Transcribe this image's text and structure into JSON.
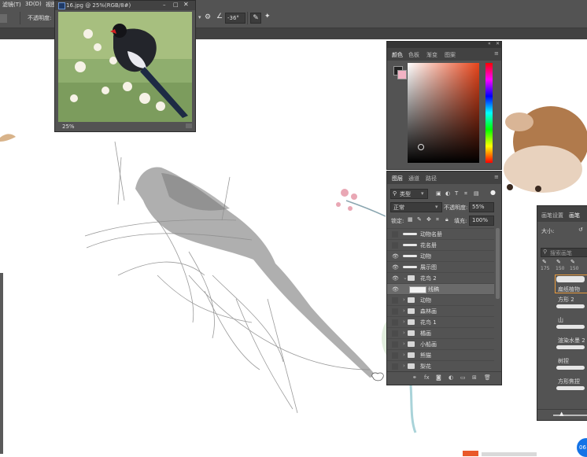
{
  "menu": {
    "items": [
      "滤镜(T)",
      "3D(D)",
      "视图"
    ]
  },
  "options_bar": {
    "opacity_label": "不透明度:",
    "angle_value": "-36°"
  },
  "navigator": {
    "file_title": "16.jpg @ 25%(RGB/8#)",
    "zoom": "25%"
  },
  "color_panel": {
    "tabs": [
      "颜色",
      "色板",
      "渐变",
      "图案"
    ],
    "active_tab": "颜色"
  },
  "layers_panel": {
    "tabs": [
      "图层",
      "通道",
      "路径"
    ],
    "active_tab": "图层",
    "filter_kind": "类型",
    "blend_mode": "正常",
    "opacity_label": "不透明度:",
    "opacity_value": "55%",
    "lock_label": "锁定:",
    "fill_label": "填充:",
    "fill_value": "100%",
    "layers": [
      {
        "name": "动物名册",
        "type": "stroke",
        "visible": false
      },
      {
        "name": "花名册",
        "type": "stroke",
        "visible": false
      },
      {
        "name": "动物",
        "type": "stroke",
        "visible": true
      },
      {
        "name": "展示图",
        "type": "stroke",
        "visible": true
      },
      {
        "name": "花鸟 2",
        "type": "folder",
        "visible": true,
        "expanded": true
      },
      {
        "name": "线稿",
        "type": "layer",
        "visible": true,
        "selected": true
      },
      {
        "name": "动物",
        "type": "folder",
        "visible": false
      },
      {
        "name": "森林画",
        "type": "folder",
        "visible": false
      },
      {
        "name": "花鸟 1",
        "type": "folder",
        "visible": false
      },
      {
        "name": "橘画",
        "type": "folder",
        "visible": false
      },
      {
        "name": "小船画",
        "type": "folder",
        "visible": false
      },
      {
        "name": "熊猫",
        "type": "folder",
        "visible": false
      },
      {
        "name": "梨花",
        "type": "folder",
        "visible": false
      }
    ]
  },
  "brush_panel": {
    "tabs": [
      "画笔设置",
      "画笔"
    ],
    "active_tab": "画笔",
    "size_label": "大小:",
    "search_placeholder": "搜索画笔",
    "preset_sizes": [
      "175",
      "150",
      "150"
    ],
    "brushes": [
      "扁纸植物",
      "方形 2",
      "山",
      "渲染水墨 2",
      "树捏",
      "方形焦捏"
    ]
  },
  "status": {
    "badge": "06"
  },
  "colors": {
    "ui_dark": "#535353",
    "panel_header": "#424242",
    "accent_blue": "#1473e6"
  }
}
